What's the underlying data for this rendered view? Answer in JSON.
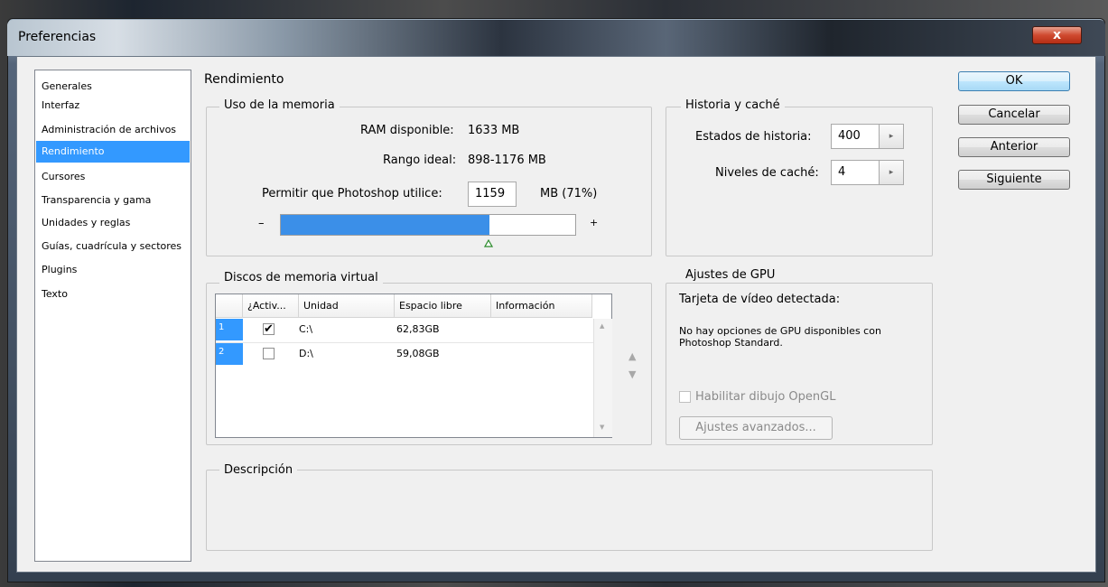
{
  "window": {
    "title": "Preferencias",
    "close_label": "x"
  },
  "sidebar": {
    "items": [
      {
        "label": "Generales"
      },
      {
        "label": "Interfaz"
      },
      {
        "label": "Administración de archivos"
      },
      {
        "label": "Rendimiento",
        "selected": true
      },
      {
        "label": "Cursores"
      },
      {
        "label": "Transparencia y gama"
      },
      {
        "label": "Unidades y reglas"
      },
      {
        "label": "Guías, cuadrícula y sectores"
      },
      {
        "label": "Plugins"
      },
      {
        "label": "Texto"
      }
    ]
  },
  "page": {
    "heading": "Rendimiento"
  },
  "memory": {
    "group_title": "Uso de la memoria",
    "ram_label": "RAM disponible:",
    "ram_value": "1633 MB",
    "range_label": "Rango ideal:",
    "range_value": "898-1176 MB",
    "allow_label": "Permitir que Photoshop utilice:",
    "allow_value": "1159",
    "allow_unit": "MB (71%)",
    "minus": "–",
    "plus": "+",
    "slider_fraction": 0.71
  },
  "history": {
    "group_title": "Historia y caché",
    "states_label": "Estados de historia:",
    "states_value": "400",
    "cache_label": "Niveles de caché:",
    "cache_value": "4",
    "spin_glyph": "▸"
  },
  "scratch": {
    "group_title": "Discos de memoria virtual",
    "columns": [
      "¿Activ...",
      "Unidad",
      "Espacio libre",
      "Información"
    ],
    "rows": [
      {
        "num": "1",
        "active": true,
        "drive": "C:\\",
        "free": "62,83GB",
        "info": ""
      },
      {
        "num": "2",
        "active": false,
        "drive": "D:\\",
        "free": "59,08GB",
        "info": ""
      }
    ],
    "up_arrow": "▲",
    "down_arrow": "▼",
    "check_glyph": "✔"
  },
  "gpu": {
    "group_title": "Ajustes de GPU",
    "detected_label": "Tarjeta de vídeo detectada:",
    "message": "No hay opciones de GPU disponibles con Photoshop Standard.",
    "opengl_label": "Habilitar dibujo OpenGL",
    "advanced_label": "Ajustes avanzados..."
  },
  "description": {
    "group_title": "Descripción"
  },
  "buttons": {
    "ok": "OK",
    "cancel": "Cancelar",
    "prev": "Anterior",
    "next": "Siguiente"
  }
}
